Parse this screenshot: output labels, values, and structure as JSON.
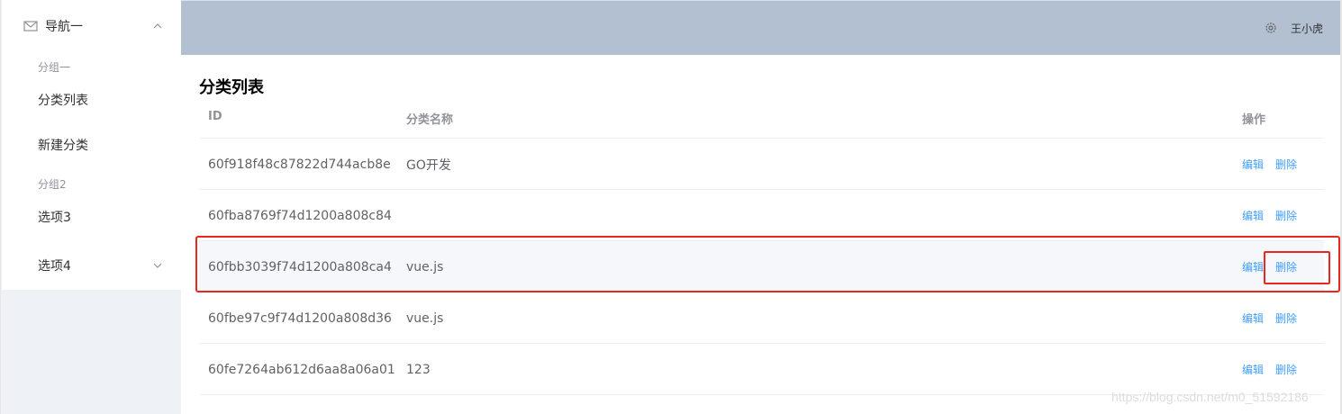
{
  "sidebar": {
    "nav_title": "导航一",
    "group1_title": "分组一",
    "items": [
      {
        "label": "分类列表"
      },
      {
        "label": "新建分类"
      },
      {
        "label": "选项3"
      },
      {
        "label": "选项4"
      }
    ],
    "group2_title": "分组2"
  },
  "header": {
    "username": "王小虎"
  },
  "main": {
    "title": "分类列表",
    "columns": {
      "id": "ID",
      "name": "分类名称",
      "actions": "操作"
    },
    "rows": [
      {
        "id": "60f918f48c87822d744acb8e",
        "name": "GO开发",
        "edit": "编辑",
        "delete": "删除"
      },
      {
        "id": "60fba8769f74d1200a808c84",
        "name": "",
        "edit": "编辑",
        "delete": "删除"
      },
      {
        "id": "60fbb3039f74d1200a808ca4",
        "name": "vue.js",
        "edit": "编辑",
        "delete": "删除"
      },
      {
        "id": "60fbe97c9f74d1200a808d36",
        "name": "vue.js",
        "edit": "编辑",
        "delete": "删除"
      },
      {
        "id": "60fe7264ab612d6aa8a06a01",
        "name": "123",
        "edit": "编辑",
        "delete": "删除"
      }
    ]
  },
  "watermark": "https://blog.csdn.net/m0_51592186",
  "icons": {
    "nav": "mail-icon",
    "expand": "chevron-up-icon",
    "collapse": "chevron-down-icon",
    "settings": "gear-icon"
  },
  "colors": {
    "header_bg": "#b3c0d1",
    "sidebar_bg": "#eef1f6",
    "link": "#409eff",
    "annotation": "#e8281e"
  }
}
